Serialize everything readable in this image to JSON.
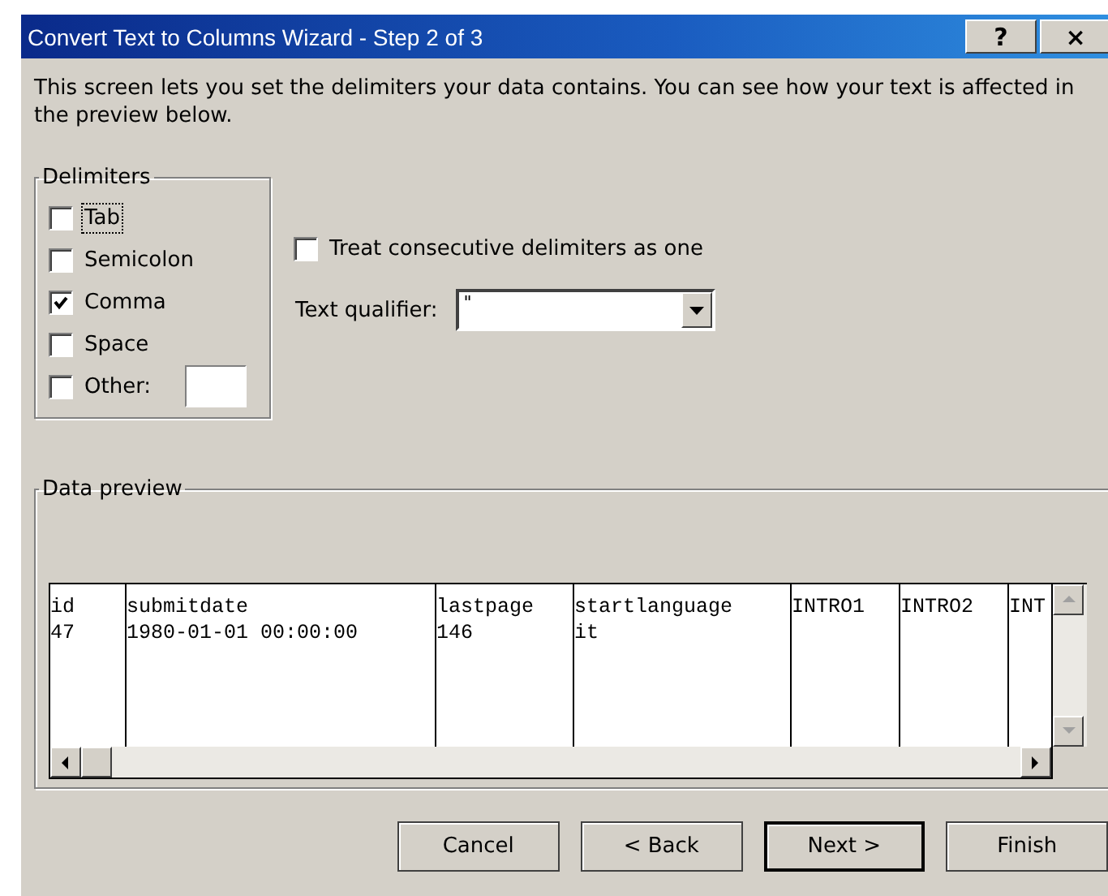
{
  "window": {
    "title": "Convert Text to Columns Wizard - Step 2 of 3",
    "title_buttons": [
      "?",
      "×"
    ]
  },
  "intro": "This screen lets you set the delimiters your data contains.  You can see how your text is affected in the preview below.",
  "delimiters": {
    "label": "Delimiters",
    "items": [
      {
        "kind": "checkbox",
        "label": "Tab",
        "checked": false,
        "focused": true
      },
      {
        "kind": "checkbox",
        "label": "Semicolon",
        "checked": false,
        "focused": false
      },
      {
        "kind": "checkbox",
        "label": "Comma",
        "checked": true,
        "focused": false
      },
      {
        "kind": "checkbox",
        "label": "Space",
        "checked": false,
        "focused": false
      },
      {
        "kind": "other",
        "label": "Other:",
        "checked": false,
        "focused": false
      }
    ]
  },
  "consecutive": {
    "label": "Treat consecutive delimiters as one",
    "checked": false
  },
  "text_qualifier": {
    "label": "Text qualifier:",
    "value": "\""
  },
  "data_preview": {
    "label": "Data preview",
    "rows": [
      [
        "id",
        "submitdate",
        "lastpage",
        "startlanguage",
        "INTRO1",
        "INTRO2",
        "INT"
      ],
      [
        "47",
        "1980-01-01 00:00:00",
        "146",
        "it"
      ]
    ]
  },
  "buttons": [
    {
      "label": "Cancel",
      "default": false
    },
    {
      "label": "< Back",
      "default": false
    },
    {
      "label": "Next >",
      "default": true
    },
    {
      "label": "Finish",
      "default": false
    }
  ]
}
